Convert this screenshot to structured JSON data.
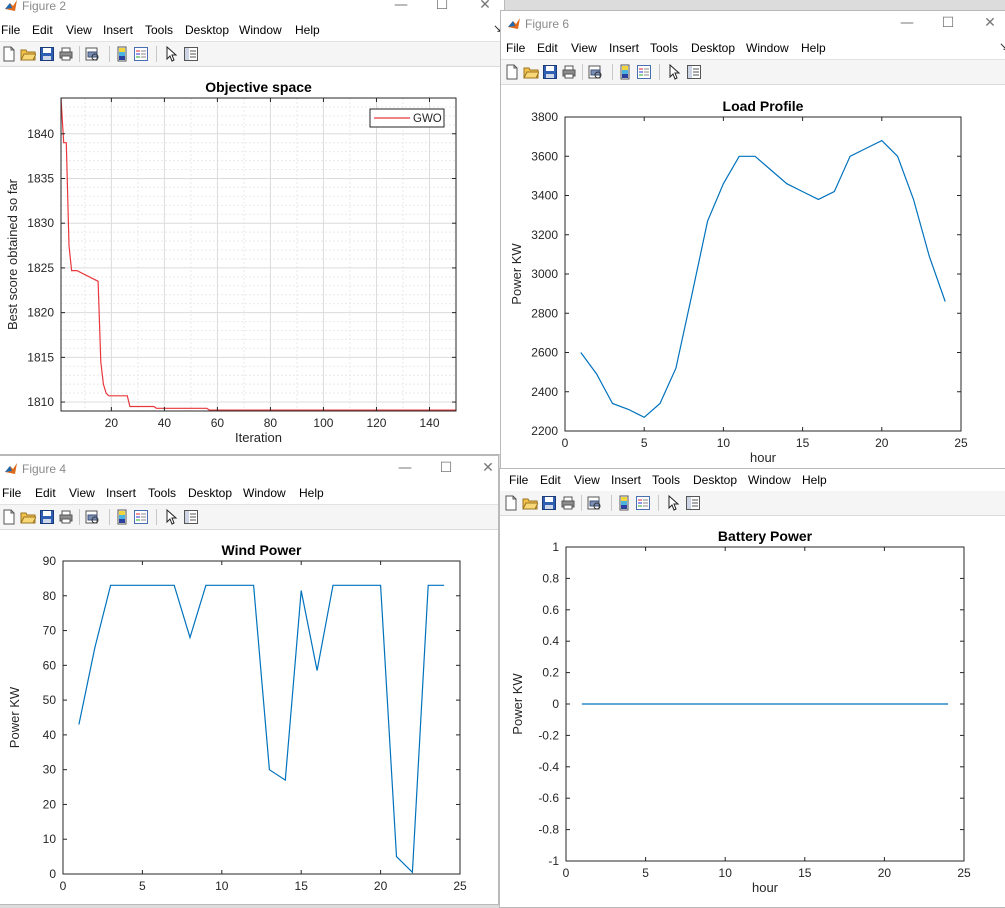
{
  "menu": [
    "File",
    "Edit",
    "View",
    "Insert",
    "Tools",
    "Desktop",
    "Window",
    "Help"
  ],
  "window_controls": {
    "minimize": "—",
    "maximize": "☐",
    "close": "✕"
  },
  "windows": {
    "fig2": {
      "title": "Figure 2"
    },
    "fig6": {
      "title": "Figure 6"
    },
    "fig4": {
      "title": "Figure 4"
    },
    "fig_battery": {
      "title": ""
    }
  },
  "colors": {
    "matlab_blue": "#0072bd",
    "gwo_red": "#e8383d",
    "axis": "#262626",
    "grid": "#dcdcdc"
  },
  "icons": [
    "new-figure-icon",
    "open-file-icon",
    "save-icon",
    "print-icon",
    "print-preview-icon",
    "colorbar-icon",
    "legend-icon",
    "pointer-icon",
    "property-editor-icon"
  ],
  "chart_data": [
    {
      "id": "objective",
      "type": "line",
      "title": "Objective space",
      "xlabel": "Iteration",
      "ylabel": "Best score obtained so far",
      "xlim": [
        1,
        150
      ],
      "ylim": [
        1809,
        1844
      ],
      "xticks": [
        20,
        40,
        60,
        80,
        100,
        120,
        140
      ],
      "yticks": [
        1810,
        1815,
        1820,
        1825,
        1830,
        1835,
        1840
      ],
      "grid": true,
      "minor_grid": true,
      "legend": {
        "position": "top-right",
        "entries": [
          "GWO"
        ]
      },
      "series": [
        {
          "name": "GWO",
          "color": "#e8383d",
          "x": [
            1,
            2,
            3,
            4,
            5,
            6,
            7,
            15,
            16,
            17,
            18,
            19,
            20,
            26,
            27,
            36,
            37,
            56,
            57,
            150
          ],
          "y": [
            1844,
            1839,
            1839,
            1827.5,
            1824.7,
            1824.7,
            1824.7,
            1823.5,
            1814.5,
            1812.0,
            1811.0,
            1810.7,
            1810.7,
            1810.7,
            1809.5,
            1809.5,
            1809.3,
            1809.3,
            1809.1,
            1809.1
          ]
        }
      ]
    },
    {
      "id": "load",
      "type": "line",
      "title": "Load Profile",
      "xlabel": "hour",
      "ylabel": "Power KW",
      "xlim": [
        0,
        25
      ],
      "ylim": [
        2200,
        3800
      ],
      "xticks": [
        0,
        5,
        10,
        15,
        20,
        25
      ],
      "yticks": [
        2200,
        2400,
        2600,
        2800,
        3000,
        3200,
        3400,
        3600,
        3800
      ],
      "grid": false,
      "series": [
        {
          "color": "#0072bd",
          "x": [
            1,
            2,
            3,
            4,
            5,
            6,
            7,
            8,
            9,
            10,
            11,
            12,
            13,
            14,
            15,
            16,
            17,
            18,
            19,
            20,
            21,
            22,
            23,
            24
          ],
          "y": [
            2600,
            2490,
            2340,
            2310,
            2270,
            2340,
            2520,
            2890,
            3270,
            3460,
            3600,
            3600,
            3530,
            3460,
            3420,
            3380,
            3420,
            3600,
            3640,
            3680,
            3600,
            3380,
            3090,
            2860
          ]
        }
      ]
    },
    {
      "id": "wind",
      "type": "line",
      "title": "Wind Power",
      "xlabel": "",
      "ylabel": "Power KW",
      "xlim": [
        0,
        25
      ],
      "ylim": [
        0,
        90
      ],
      "xticks": [
        0,
        5,
        10,
        15,
        20,
        25
      ],
      "yticks": [
        0,
        10,
        20,
        30,
        40,
        50,
        60,
        70,
        80,
        90
      ],
      "grid": false,
      "series": [
        {
          "color": "#0072bd",
          "x": [
            1,
            2,
            3,
            4,
            5,
            6,
            7,
            8,
            9,
            10,
            11,
            12,
            13,
            14,
            15,
            16,
            17,
            18,
            19,
            20,
            21,
            22,
            23,
            24
          ],
          "y": [
            43,
            65,
            83,
            83,
            83,
            83,
            83,
            68,
            83,
            83,
            83,
            83,
            30,
            27,
            81.5,
            58.5,
            83,
            83,
            83,
            83,
            5,
            0.5,
            83,
            83
          ]
        }
      ]
    },
    {
      "id": "battery",
      "type": "line",
      "title": "Battery Power",
      "xlabel": "hour",
      "ylabel": "Power KW",
      "xlim": [
        0,
        25
      ],
      "ylim": [
        -1,
        1
      ],
      "xticks": [
        0,
        5,
        10,
        15,
        20,
        25
      ],
      "yticks": [
        -1,
        -0.8,
        -0.6,
        -0.4,
        -0.2,
        0,
        0.2,
        0.4,
        0.6,
        0.8,
        1
      ],
      "grid": false,
      "series": [
        {
          "color": "#0072bd",
          "x": [
            1,
            24
          ],
          "y": [
            0,
            0
          ]
        }
      ]
    }
  ]
}
